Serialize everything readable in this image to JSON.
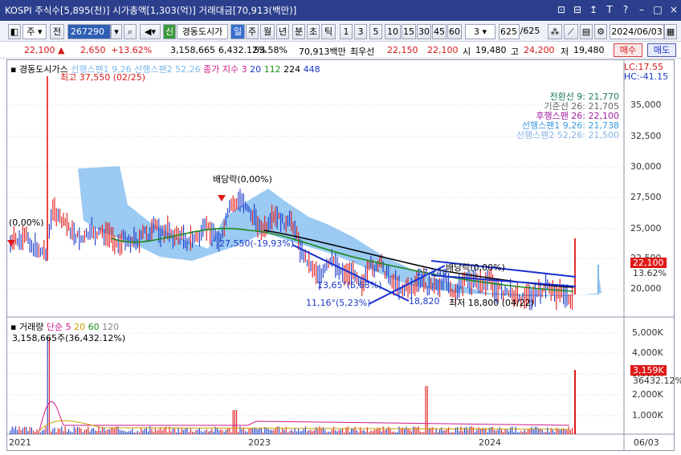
{
  "window": {
    "title": "KOSPI 주식수[5,895(천)] 시가총액[1,303(억)] 거래대금[70,913(백만)]",
    "controls": [
      "⊡",
      "⊟",
      "↥",
      "T",
      "?",
      "–",
      "□",
      "×"
    ]
  },
  "toolbar": {
    "type_label": "주",
    "market_label": "전",
    "ticker_code": "267290",
    "new_badge": "신",
    "stock_name": "경동도시가",
    "periods": [
      "일",
      "주",
      "월",
      "년",
      "분",
      "초",
      "틱"
    ],
    "intervals": [
      "1",
      "3",
      "5",
      "10",
      "15",
      "30",
      "45",
      "60"
    ],
    "interval_select": "3",
    "bar_count": "625",
    "bar_total": "/625",
    "date": "2024/06/03"
  },
  "quote": {
    "price": "22,100",
    "change": "2,650",
    "change_pct": "+13.62%",
    "volume": "3,158,665",
    "volume_pct": "6,432.12%",
    "ratio": "53.58%",
    "amount": "70,913백만",
    "best_ask_label": "최우선",
    "best_ask": "22,150",
    "best_bid": "22,100",
    "open_label": "시",
    "open": "19,480",
    "high_label": "고",
    "high": "24,200",
    "low_label": "저",
    "low": "19,480",
    "buy_label": "매수",
    "sell_label": "매도"
  },
  "chart": {
    "legend": {
      "name": "경동도시가스",
      "span1": "선행스팬1 9,26",
      "span2": "선행스팬2 52,26",
      "ma_label": "종가 지수 3",
      "ma_periods": [
        "20",
        "112",
        "224",
        "448"
      ]
    },
    "lc": "LC:17.55",
    "hc": "HC:-41.15",
    "ichimoku": [
      {
        "label": "전환선 9: 21,770",
        "color": "#1a7a5a"
      },
      {
        "label": "기준선 26: 21,705",
        "color": "#666666"
      },
      {
        "label": "후행스팬 26: 22,100",
        "color": "#a020a0"
      },
      {
        "label": "선행스팬1 9,26: 21,738",
        "color": "#3a9ae0"
      },
      {
        "label": "선행스팬2 52,26: 21,500",
        "color": "#8ab4e8"
      }
    ],
    "annotations": {
      "max": "최고 37,550 (02/25)",
      "min": "최저 18,800 (04/22)",
      "left_pct": "(0,00%)",
      "dividend1": "배당락(0,00%)",
      "dividend2": "배당락(0,00%)",
      "a1": "27,550(-19,93%)",
      "a2": "13,65°(5,63%)",
      "a3": "11,16°(5,23%)",
      "a4": "18,820",
      "a5": "27,240"
    },
    "y_ticks": [
      "35,000",
      "32,500",
      "30,000",
      "27,500",
      "25,000",
      "22,500",
      "20,000"
    ],
    "current_price": "22,100",
    "current_pct": "13.62%"
  },
  "volume_panel": {
    "legend_name": "거래량",
    "legend_ma_label": "단순",
    "legend_periods": [
      "5",
      "20",
      "60",
      "120"
    ],
    "legend_colors": [
      "#d01a8a",
      "#c8a000",
      "#1a8a1a",
      "#888888"
    ],
    "value": "3,158,665주(36,432.12%)",
    "y_ticks": [
      "5,000K",
      "4,000K",
      "3,000K",
      "2,000K",
      "1,000K"
    ],
    "current": "3,159K",
    "current_pct": "36432.12%"
  },
  "x_axis": [
    "2021",
    "2023",
    "2024",
    "06/03"
  ],
  "colors": {
    "up": "#e01818",
    "down": "#1a39c8",
    "title_bar": "#2b3f8c",
    "cloud": "#7ab8ee"
  }
}
